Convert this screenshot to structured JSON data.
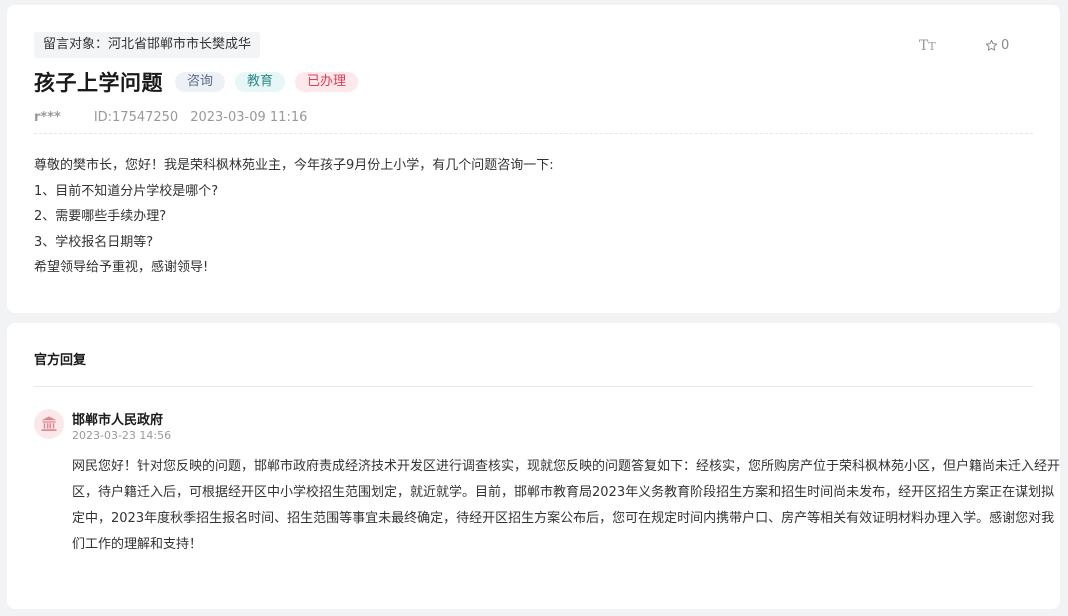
{
  "message": {
    "recipient": "留言对象：河北省邯郸市市长樊成华",
    "title": "孩子上学问题",
    "tags": [
      "咨询",
      "教育",
      "已办理"
    ],
    "font_size_label": "TT",
    "favorite_count": "0",
    "user": "r***",
    "id": "ID:17547250",
    "datetime": "2023-03-09 11:16",
    "body_lines": [
      "尊敬的樊市长，您好！我是荣科枫林苑业主，今年孩子9月份上小学，有几个问题咨询一下:",
      "1、目前不知道分片学校是哪个?",
      "2、需要哪些手续办理?",
      "3、学校报名日期等?",
      "希望领导给予重视，感谢领导!"
    ]
  },
  "reply": {
    "heading": "官方回复",
    "org_name": "邯郸市人民政府",
    "datetime": "2023-03-23 14:56",
    "body_lines": [
      "网民您好！针对您反映的问题，邯郸市政府责成经济技术开发区进行调查核实，现就您反映的问题答复如下：经核实，您所购房产位于荣科枫林苑小区，但户籍尚未迁入经开",
      "区，待户籍迁入后，可根据经开区中小学校招生范围划定，就近就学。目前，邯郸市教育局2023年义务教育阶段招生方案和招生时间尚未发布，经开区招生方案正在谋划拟",
      "定中，2023年度秋季招生报名时间、招生范围等事宜未最终确定，待经开区招生方案公布后，您可在规定时间内携带户口、房产等相关有效证明材料办理入学。感谢您对我",
      "们工作的理解和支持！"
    ]
  },
  "colors": {
    "tag_done": "#e03c52",
    "tag_edu": "#2e8a8a",
    "tag_consult": "#5a6b85",
    "gov_icon": "#e0838f"
  },
  "icons": {
    "font_size": "font-size-icon",
    "favorite": "star-icon",
    "gov": "government-building-icon"
  }
}
